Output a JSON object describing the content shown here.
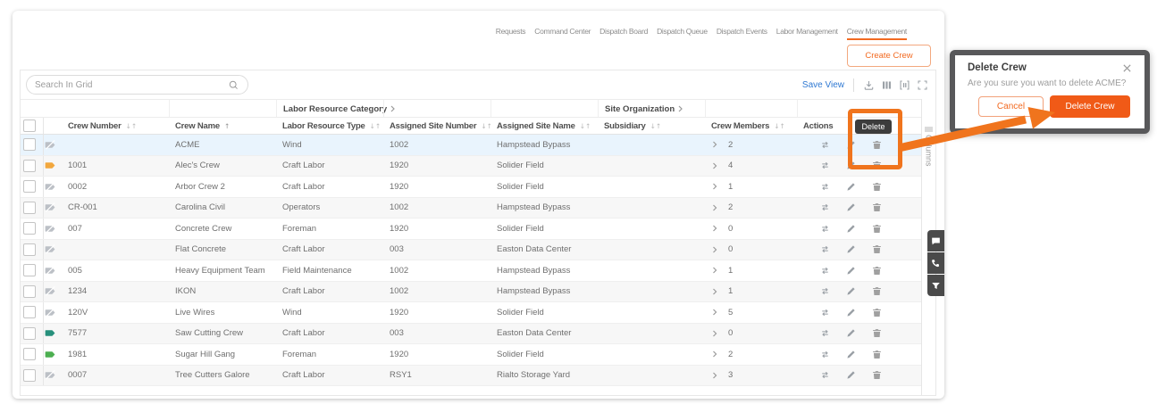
{
  "tabs": {
    "items": [
      {
        "label": "Requests",
        "active": false
      },
      {
        "label": "Command Center",
        "active": false
      },
      {
        "label": "Dispatch Board",
        "active": false
      },
      {
        "label": "Dispatch Queue",
        "active": false
      },
      {
        "label": "Dispatch Events",
        "active": false
      },
      {
        "label": "Labor Management",
        "active": false
      },
      {
        "label": "Crew Management",
        "active": true
      }
    ]
  },
  "toolbar": {
    "create_crew_label": "Create Crew",
    "save_view_label": "Save View"
  },
  "search": {
    "placeholder": "Search In Grid"
  },
  "grid": {
    "group_headers": [
      {
        "label": "Labor Resource Category"
      },
      {
        "label": "Site Organization"
      }
    ],
    "columns": [
      {
        "label": "Crew Number",
        "sort": "both"
      },
      {
        "label": "Crew Name",
        "sort": "asc"
      },
      {
        "label": "Labor Resource Type",
        "sort": "both"
      },
      {
        "label": "Assigned Site Number",
        "sort": "both"
      },
      {
        "label": "Assigned Site Name",
        "sort": "both"
      },
      {
        "label": "Subsidiary",
        "sort": "both"
      },
      {
        "label": "Crew Members",
        "sort": "both"
      },
      {
        "label": "Actions",
        "sort": ""
      }
    ],
    "columns_panel_label": "Columns",
    "rows": [
      {
        "crew_number": "",
        "crew_name": "ACME",
        "tag": "off",
        "labor_resource_type": "Wind",
        "assigned_site_number": "1002",
        "assigned_site_name": "Hampstead Bypass",
        "subsidiary": "",
        "crew_members": "2",
        "highlight": true
      },
      {
        "crew_number": "1001",
        "crew_name": "Alec's Crew",
        "tag": "amber",
        "labor_resource_type": "Craft Labor",
        "assigned_site_number": "1920",
        "assigned_site_name": "Solider Field",
        "subsidiary": "",
        "crew_members": "4"
      },
      {
        "crew_number": "0002",
        "crew_name": "Arbor Crew 2",
        "tag": "off",
        "labor_resource_type": "Craft Labor",
        "assigned_site_number": "1920",
        "assigned_site_name": "Solider Field",
        "subsidiary": "",
        "crew_members": "1"
      },
      {
        "crew_number": "CR-001",
        "crew_name": "Carolina Civil",
        "tag": "off",
        "labor_resource_type": "Operators",
        "assigned_site_number": "1002",
        "assigned_site_name": "Hampstead Bypass",
        "subsidiary": "",
        "crew_members": "2"
      },
      {
        "crew_number": "007",
        "crew_name": "Concrete Crew",
        "tag": "off",
        "labor_resource_type": "Foreman",
        "assigned_site_number": "1920",
        "assigned_site_name": "Solider Field",
        "subsidiary": "",
        "crew_members": "0"
      },
      {
        "crew_number": "",
        "crew_name": "Flat Concrete",
        "tag": "off",
        "labor_resource_type": "Craft Labor",
        "assigned_site_number": "003",
        "assigned_site_name": "Easton Data Center",
        "subsidiary": "",
        "crew_members": "0"
      },
      {
        "crew_number": "005",
        "crew_name": "Heavy Equipment Team",
        "tag": "off",
        "labor_resource_type": "Field Maintenance",
        "assigned_site_number": "1002",
        "assigned_site_name": "Hampstead Bypass",
        "subsidiary": "",
        "crew_members": "1"
      },
      {
        "crew_number": "1234",
        "crew_name": "IKON",
        "tag": "off",
        "labor_resource_type": "Craft Labor",
        "assigned_site_number": "1002",
        "assigned_site_name": "Hampstead Bypass",
        "subsidiary": "",
        "crew_members": "1"
      },
      {
        "crew_number": "120V",
        "crew_name": "Live Wires",
        "tag": "off",
        "labor_resource_type": "Wind",
        "assigned_site_number": "1920",
        "assigned_site_name": "Solider Field",
        "subsidiary": "",
        "crew_members": "5"
      },
      {
        "crew_number": "7577",
        "crew_name": "Saw Cutting Crew",
        "tag": "teal",
        "labor_resource_type": "Craft Labor",
        "assigned_site_number": "003",
        "assigned_site_name": "Easton Data Center",
        "subsidiary": "",
        "crew_members": "0"
      },
      {
        "crew_number": "1981",
        "crew_name": "Sugar Hill Gang",
        "tag": "green",
        "labor_resource_type": "Foreman",
        "assigned_site_number": "1920",
        "assigned_site_name": "Solider Field",
        "subsidiary": "",
        "crew_members": "2"
      },
      {
        "crew_number": "0007",
        "crew_name": "Tree Cutters Galore",
        "tag": "off",
        "labor_resource_type": "Craft Labor",
        "assigned_site_number": "RSY1",
        "assigned_site_name": "Rialto Storage Yard",
        "subsidiary": "",
        "crew_members": "3"
      }
    ]
  },
  "tooltip": {
    "label": "Delete"
  },
  "dialog": {
    "title": "Delete Crew",
    "message": "Are you sure you want to delete ACME?",
    "cancel_label": "Cancel",
    "confirm_label": "Delete Crew"
  },
  "colors": {
    "accent_orange": "#f26a21",
    "annotation_orange": "#f0741d",
    "link_blue": "#2e78d2",
    "highlight_row": "#e9f4fd"
  }
}
